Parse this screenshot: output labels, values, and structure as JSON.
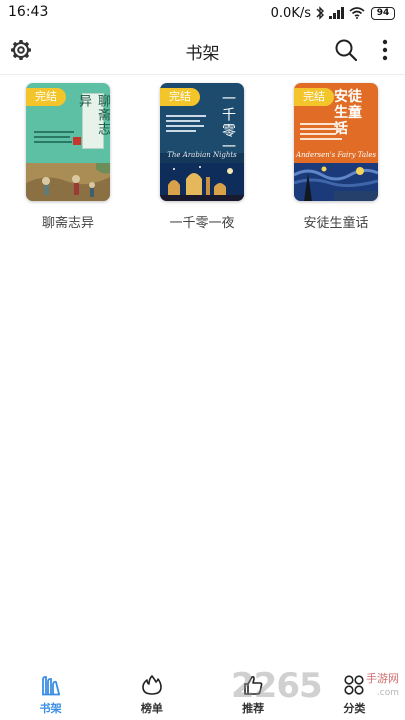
{
  "status_bar": {
    "time": "16:43",
    "network_speed": "0.0K/s",
    "battery": "94",
    "icons": [
      "bluetooth-icon",
      "signal-icon",
      "wifi-icon",
      "battery-icon"
    ]
  },
  "app_bar": {
    "title": "书架",
    "left_icon": "gear-icon",
    "right_icons": [
      "search-icon",
      "more-vertical-icon"
    ]
  },
  "books": [
    {
      "title": "聊斋志异",
      "badge": "完结",
      "cover_title": "聊斋志异",
      "colors": {
        "top": "#5dbfa4",
        "bottom": "#b59b5e"
      }
    },
    {
      "title": "一千零一夜",
      "badge": "完结",
      "cover_title": "一千零一夜",
      "cover_subtitle": "The Arabian Nights",
      "colors": {
        "top": "#1c4b6d",
        "bottom": "#0f2d5a"
      }
    },
    {
      "title": "安徒生童话",
      "badge": "完结",
      "cover_title": "安徒生童话",
      "cover_subtitle": "Andersen's Fairy Tales",
      "colors": {
        "top": "#e06c26",
        "bottom": "#1b3a7a"
      }
    }
  ],
  "bottom_nav": {
    "active": "书架",
    "active_color": "#3a8ee6",
    "items": [
      {
        "label": "书架",
        "icon": "bookshelf-icon"
      },
      {
        "label": "榜单",
        "icon": "flame-icon"
      },
      {
        "label": "推荐",
        "icon": "thumb-up-icon"
      },
      {
        "label": "分类",
        "icon": "category-grid-icon"
      }
    ]
  },
  "watermark": {
    "text": "2265",
    "sub": "手游网",
    "url": ".com"
  }
}
